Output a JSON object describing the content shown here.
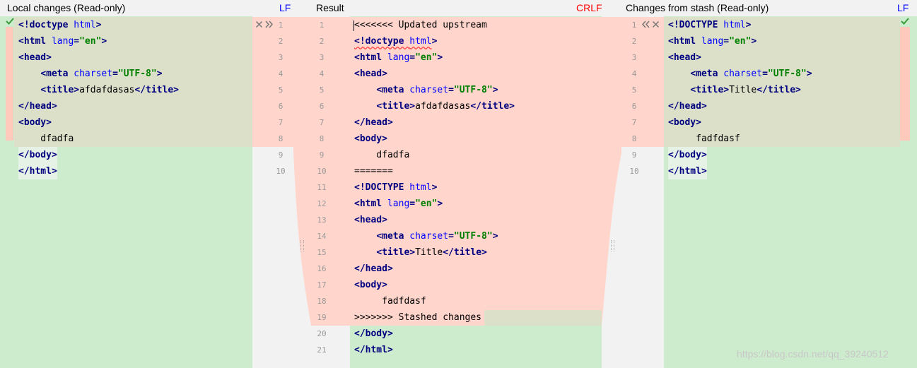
{
  "headers": {
    "left_title": "Local changes (Read-only)",
    "left_eol": "LF",
    "middle_title": "Result",
    "middle_eol": "CRLF",
    "right_title": "Changes from stash (Read-only)",
    "right_eol": "LF"
  },
  "colors": {
    "conflict_bg": "#ffd5cc",
    "olive_bg": "#dce0c9",
    "added_bg": "#cdebcd",
    "gutter_bg": "#f2f2f2",
    "keyword": "#000080",
    "attribute": "#0000ff",
    "string": "#008000",
    "eol_lf": "#0000ff",
    "eol_crlf": "#ff0000",
    "check": "#3a9c3a"
  },
  "icons": {
    "left_check": "check-icon",
    "left_discard": "close-icon",
    "left_apply": "double-chevron-right-icon",
    "right_apply": "double-chevron-left-icon",
    "right_discard": "close-icon",
    "right_check": "check-icon"
  },
  "left": {
    "line_numbers": [
      "1",
      "2",
      "3",
      "4",
      "5",
      "6",
      "7",
      "8",
      "9",
      "10"
    ],
    "lines": [
      [
        [
          "kw",
          "<!doctype "
        ],
        [
          "attr",
          "html"
        ],
        [
          "kw",
          ">"
        ]
      ],
      [
        [
          "kw",
          "<html "
        ],
        [
          "attr",
          "lang"
        ],
        [
          "kw",
          "="
        ],
        [
          "str",
          "\"en\""
        ],
        [
          "kw",
          ">"
        ]
      ],
      [
        [
          "kw",
          "<head>"
        ]
      ],
      [
        [
          "txt",
          "    "
        ],
        [
          "kw",
          "<meta "
        ],
        [
          "attr",
          "charset"
        ],
        [
          "kw",
          "="
        ],
        [
          "str",
          "\"UTF-8\""
        ],
        [
          "kw",
          ">"
        ]
      ],
      [
        [
          "txt",
          "    "
        ],
        [
          "kw",
          "<title>"
        ],
        [
          "txt",
          "afdafdasas"
        ],
        [
          "kw",
          "</title>"
        ]
      ],
      [
        [
          "kw",
          "</head>"
        ]
      ],
      [
        [
          "kw",
          "<body>"
        ]
      ],
      [
        [
          "txt",
          "    dfadfa"
        ]
      ],
      [
        [
          "kw",
          "</body>"
        ]
      ],
      [
        [
          "kw",
          "</html>"
        ]
      ]
    ]
  },
  "middle": {
    "line_numbers": [
      "1",
      "2",
      "3",
      "4",
      "5",
      "6",
      "7",
      "8",
      "9",
      "10",
      "11",
      "12",
      "13",
      "14",
      "15",
      "16",
      "17",
      "18",
      "19",
      "20",
      "21"
    ],
    "lines": [
      [
        [
          "txt",
          "<<<<<<< Updated upstream"
        ]
      ],
      [
        [
          "kwwavy",
          "<!doctype "
        ],
        [
          "attrwavy",
          "html"
        ],
        [
          "kw",
          ">"
        ]
      ],
      [
        [
          "kw",
          "<html "
        ],
        [
          "attr",
          "lang"
        ],
        [
          "kw",
          "="
        ],
        [
          "str",
          "\"en\""
        ],
        [
          "kw",
          ">"
        ]
      ],
      [
        [
          "kw",
          "<head>"
        ]
      ],
      [
        [
          "txt",
          "    "
        ],
        [
          "kw",
          "<meta "
        ],
        [
          "attr",
          "charset"
        ],
        [
          "kw",
          "="
        ],
        [
          "str",
          "\"UTF-8\""
        ],
        [
          "kw",
          ">"
        ]
      ],
      [
        [
          "txt",
          "    "
        ],
        [
          "kw",
          "<title>"
        ],
        [
          "txt",
          "afdafdasas"
        ],
        [
          "kw",
          "</title>"
        ]
      ],
      [
        [
          "kw",
          "</head>"
        ]
      ],
      [
        [
          "kw",
          "<body>"
        ]
      ],
      [
        [
          "txt",
          "    dfadfa"
        ]
      ],
      [
        [
          "txt",
          "======="
        ]
      ],
      [
        [
          "kw",
          "<!DOCTYPE "
        ],
        [
          "attr",
          "html"
        ],
        [
          "kw",
          ">"
        ]
      ],
      [
        [
          "kw",
          "<html "
        ],
        [
          "attr",
          "lang"
        ],
        [
          "kw",
          "="
        ],
        [
          "str",
          "\"en\""
        ],
        [
          "kw",
          ">"
        ]
      ],
      [
        [
          "kw",
          "<head>"
        ]
      ],
      [
        [
          "txt",
          "    "
        ],
        [
          "kw",
          "<meta "
        ],
        [
          "attr",
          "charset"
        ],
        [
          "kw",
          "="
        ],
        [
          "str",
          "\"UTF-8\""
        ],
        [
          "kw",
          ">"
        ]
      ],
      [
        [
          "txt",
          "    "
        ],
        [
          "kw",
          "<title>"
        ],
        [
          "txt",
          "Title"
        ],
        [
          "kw",
          "</title>"
        ]
      ],
      [
        [
          "kw",
          "</head>"
        ]
      ],
      [
        [
          "kw",
          "<body>"
        ]
      ],
      [
        [
          "txt",
          "     fadfdasf"
        ]
      ],
      [
        [
          "txt",
          ">>>>>>> Stashed changes"
        ]
      ],
      [
        [
          "kw",
          "</body>"
        ]
      ],
      [
        [
          "kw",
          "</html>"
        ]
      ]
    ]
  },
  "right": {
    "line_numbers": [
      "1",
      "2",
      "3",
      "4",
      "5",
      "6",
      "7",
      "8",
      "9",
      "10"
    ],
    "lines": [
      [
        [
          "kw",
          "<!DOCTYPE "
        ],
        [
          "attr",
          "html"
        ],
        [
          "kw",
          ">"
        ]
      ],
      [
        [
          "kw",
          "<html "
        ],
        [
          "attr",
          "lang"
        ],
        [
          "kw",
          "="
        ],
        [
          "str",
          "\"en\""
        ],
        [
          "kw",
          ">"
        ]
      ],
      [
        [
          "kw",
          "<head>"
        ]
      ],
      [
        [
          "txt",
          "    "
        ],
        [
          "kw",
          "<meta "
        ],
        [
          "attr",
          "charset"
        ],
        [
          "kw",
          "="
        ],
        [
          "str",
          "\"UTF-8\""
        ],
        [
          "kw",
          ">"
        ]
      ],
      [
        [
          "txt",
          "    "
        ],
        [
          "kw",
          "<title>"
        ],
        [
          "txt",
          "Title"
        ],
        [
          "kw",
          "</title>"
        ]
      ],
      [
        [
          "kw",
          "</head>"
        ]
      ],
      [
        [
          "kw",
          "<body>"
        ]
      ],
      [
        [
          "txt",
          "     fadfdasf"
        ]
      ],
      [
        [
          "kw",
          "</body>"
        ]
      ],
      [
        [
          "kw",
          "</html>"
        ]
      ]
    ]
  },
  "watermark": "https://blog.csdn.net/qq_39240512"
}
